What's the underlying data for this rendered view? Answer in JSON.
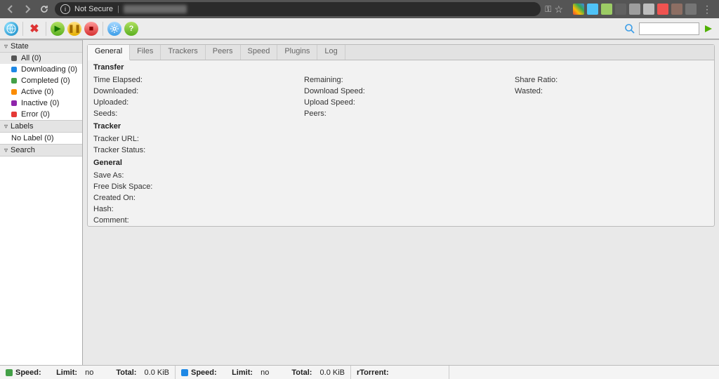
{
  "browser": {
    "not_secure": "Not Secure",
    "key_icon": "key-icon",
    "star_icon": "star-icon"
  },
  "toolbar": {
    "search_placeholder": ""
  },
  "sidebar": {
    "state_header": "State",
    "labels_header": "Labels",
    "search_header": "Search",
    "state": [
      {
        "label": "All (0)",
        "color": "#555",
        "name": "all"
      },
      {
        "label": "Downloading (0)",
        "color": "#1e88e5",
        "name": "downloading"
      },
      {
        "label": "Completed (0)",
        "color": "#43a047",
        "name": "completed"
      },
      {
        "label": "Active (0)",
        "color": "#fb8c00",
        "name": "active"
      },
      {
        "label": "Inactive (0)",
        "color": "#8e24aa",
        "name": "inactive"
      },
      {
        "label": "Error (0)",
        "color": "#e53935",
        "name": "error"
      }
    ],
    "labels": [
      {
        "label": "No Label (0)",
        "name": "no-label"
      }
    ]
  },
  "tabs": [
    "General",
    "Files",
    "Trackers",
    "Peers",
    "Speed",
    "Plugins",
    "Log"
  ],
  "details": {
    "transfer_header": "Transfer",
    "tracker_header": "Tracker",
    "general_header": "General",
    "transfer": {
      "time_elapsed": "Time Elapsed:",
      "downloaded": "Downloaded:",
      "uploaded": "Uploaded:",
      "seeds": "Seeds:",
      "remaining": "Remaining:",
      "dl_speed": "Download Speed:",
      "ul_speed": "Upload Speed:",
      "peers": "Peers:",
      "share_ratio": "Share Ratio:",
      "wasted": "Wasted:"
    },
    "tracker": {
      "url": "Tracker URL:",
      "status": "Tracker Status:"
    },
    "general": {
      "save_as": "Save As:",
      "free_disk": "Free Disk Space:",
      "created": "Created On:",
      "hash": "Hash:",
      "comment": "Comment:"
    }
  },
  "status": {
    "up": {
      "speed_label": "Speed:",
      "limit_label": "Limit:",
      "limit_val": "no",
      "total_label": "Total:",
      "total_val": "0.0 KiB",
      "color": "#43a047"
    },
    "down": {
      "speed_label": "Speed:",
      "limit_label": "Limit:",
      "limit_val": "no",
      "total_label": "Total:",
      "total_val": "0.0 KiB",
      "color": "#1e88e5"
    },
    "client_label": "rTorrent:"
  }
}
